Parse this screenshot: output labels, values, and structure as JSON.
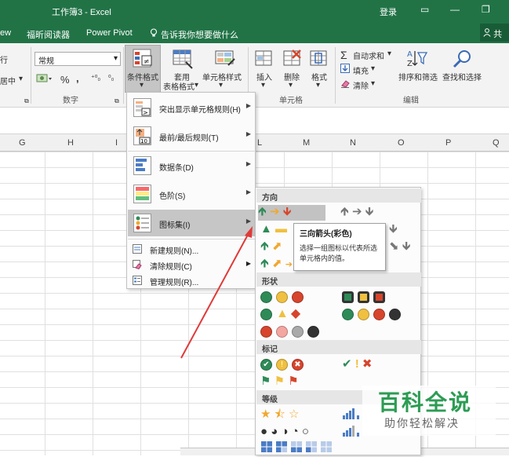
{
  "window": {
    "title": "工作簿3  -  Excel",
    "login_label": "登录",
    "restore_glyph": "▭",
    "minimize_glyph": "—",
    "maximize_glyph": "❐"
  },
  "menubar": {
    "items": [
      "ew",
      "福昕阅读器",
      "Power Pivot"
    ],
    "tell_me": "告诉我你想要做什么",
    "share_label": "共"
  },
  "ribbon": {
    "partial_left_top": "行",
    "partial_left_mid": "居中",
    "number_format": "常规",
    "percent": "%",
    "comma": ",",
    "dec_increase": "⁺⁰₀",
    "dec_decrease": "⁰₀",
    "conditional_format": "条件格式",
    "table_format_line1": "套用",
    "table_format_line2": "表格格式",
    "cell_styles": "单元格样式",
    "insert": "插入",
    "delete": "删除",
    "format": "格式",
    "autosum": "自动求和",
    "fill": "填充",
    "clear": "清除",
    "sort_filter": "排序和筛选",
    "find_select": "查找和选择",
    "groups": {
      "number": "数字",
      "cells": "单元格",
      "editing": "编辑"
    }
  },
  "columns": [
    "G",
    "H",
    "I",
    "L",
    "M",
    "N",
    "O",
    "P",
    "Q"
  ],
  "cf_menu": {
    "highlight": "突出显示单元格规则(H)",
    "topbottom": "最前/最后规则(T)",
    "databars": "数据条(D)",
    "colorscales": "色阶(S)",
    "iconsets": "图标集(I)",
    "new_rule": "新建规则(N)...",
    "clear_rules": "清除规则(C)",
    "manage_rules": "管理规则(R)..."
  },
  "iconset_submenu": {
    "sections": {
      "direction": "方向",
      "shapes": "形状",
      "indicators": "标记",
      "ratings": "等级"
    },
    "direction_rows": [
      "🡹 ➪ 🡻",
      "▲ ▬ ▼",
      "🡹 ⬈ ⬊ 🡻",
      "🡹 ⬈ ⬊"
    ],
    "direction_rows_right": [
      "🡹 ➔ 🡻",
      "🡻",
      "⬊ 🡻"
    ],
    "indicator_row1_left": "✔ ! ✖",
    "indicator_row1_right": "✓ ! ✗",
    "indicator_row2": "⚑ ⚑ ⚑",
    "ratings_row1": "★ ⯪ ☆",
    "ratings_row2": "● ◕ ◑ ◔ ○"
  },
  "tooltip": {
    "title": "三向箭头(彩色)",
    "description": "选择一组图标以代表所选单元格内的值。"
  },
  "watermark": {
    "name": "百科全说",
    "subtitle": "助你轻松解决"
  },
  "colors": {
    "excel_green": "#217346",
    "arrow_green": "#2e8b57",
    "arrow_yellow": "#f0a830",
    "arrow_red": "#d6452c",
    "annotation_red": "#e03a3a"
  }
}
